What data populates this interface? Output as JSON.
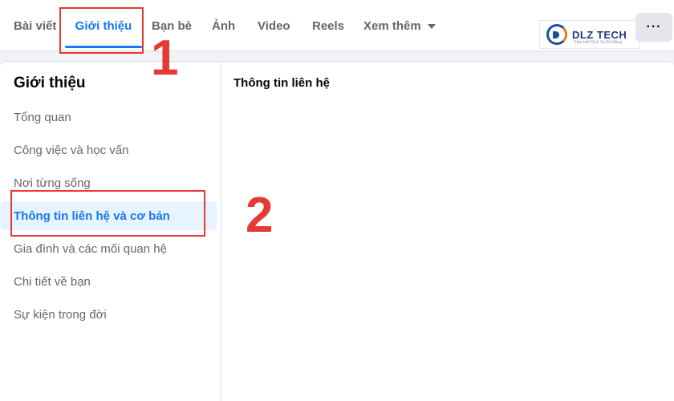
{
  "tabs": [
    {
      "label": "Bài viết"
    },
    {
      "label": "Giới thiệu"
    },
    {
      "label": "Bạn bè"
    },
    {
      "label": "Ảnh"
    },
    {
      "label": "Video"
    },
    {
      "label": "Reels"
    },
    {
      "label": "Xem thêm"
    }
  ],
  "more_button_label": "···",
  "logo": {
    "text": "DLZ TECH",
    "subtitle": "Cảm biết Dịch Vụ Đà Nẵng"
  },
  "sidebar": {
    "title": "Giới thiệu",
    "items": [
      {
        "label": "Tổng quan"
      },
      {
        "label": "Công việc và học vấn"
      },
      {
        "label": "Nơi từng sống"
      },
      {
        "label": "Thông tin liên hệ và cơ bản"
      },
      {
        "label": "Gia đình và các mối quan hệ"
      },
      {
        "label": "Chi tiết về bạn"
      },
      {
        "label": "Sự kiện trong đời"
      }
    ]
  },
  "content": {
    "title": "Thông tin liên hệ"
  },
  "annotations": [
    {
      "label": "1"
    },
    {
      "label": "2"
    }
  ],
  "colors": {
    "accent": "#1877f2",
    "annotation": "#e53935",
    "active_bg": "#e7f3ff"
  }
}
